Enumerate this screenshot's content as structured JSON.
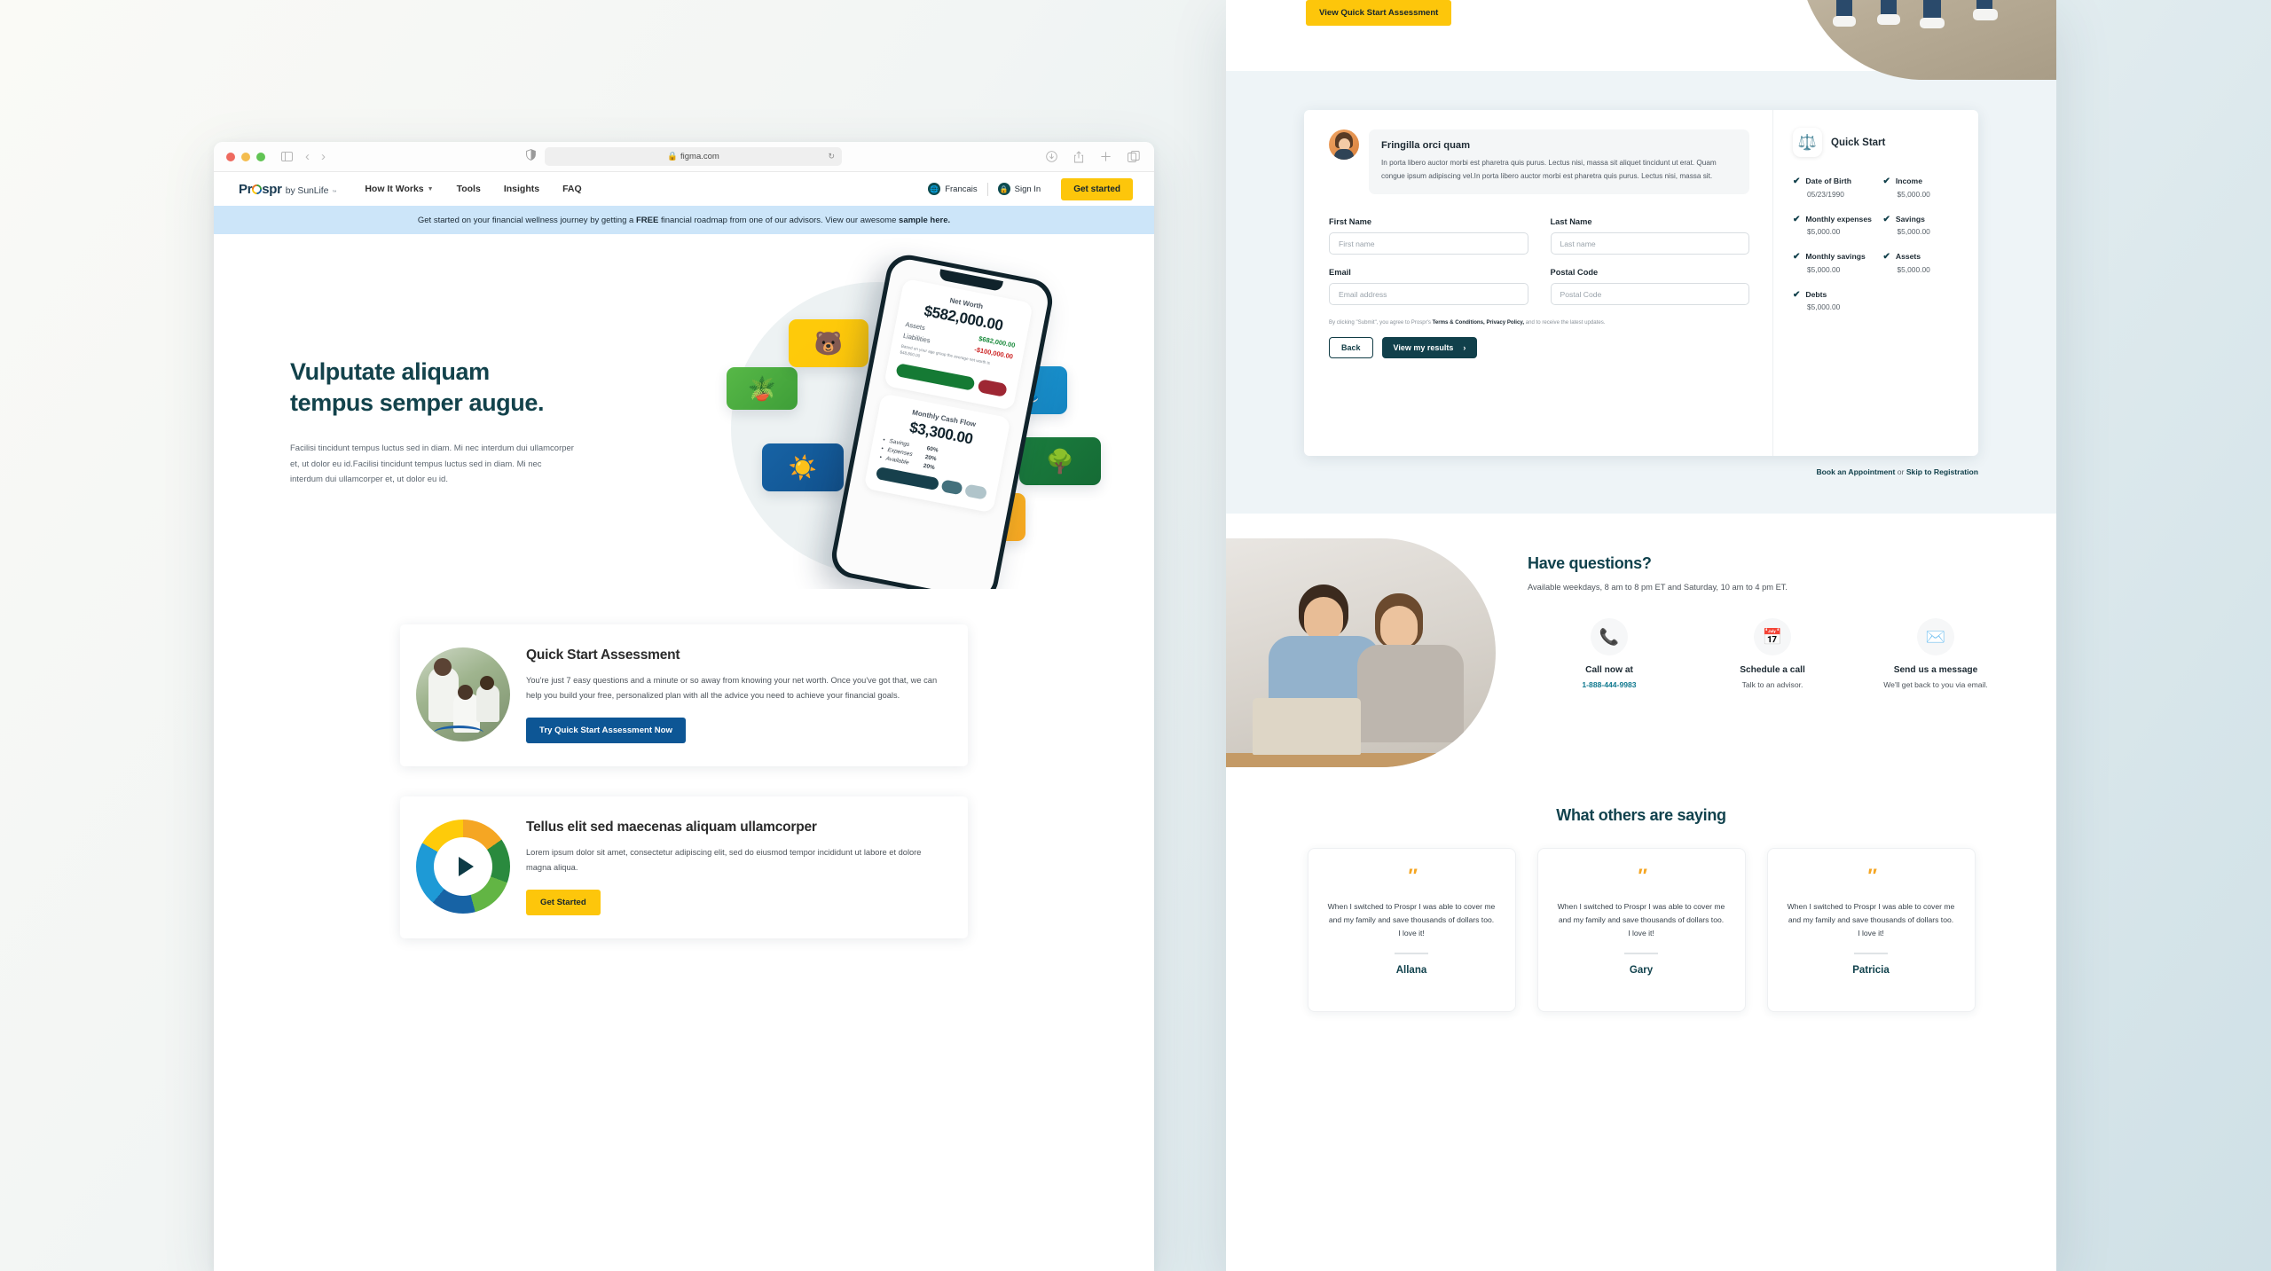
{
  "browser": {
    "url": "figma.com",
    "lock_icon": "lock-icon",
    "reload_icon": "reload-icon",
    "sidebar_icon": "sidebar-toggle-icon",
    "back_icon": "back-arrow-icon",
    "forward_icon": "forward-arrow-icon",
    "shield_icon": "shield-icon",
    "download_icon": "download-icon",
    "share_icon": "share-icon",
    "newtab_icon": "plus-icon",
    "tabs_icon": "tabs-icon"
  },
  "nav": {
    "brand_name": "Prospr",
    "brand_o": "o",
    "brand_suffix": "by SunLife",
    "brand_tm": "™",
    "links": [
      {
        "label": "How It Works",
        "has_caret": true
      },
      {
        "label": "Tools",
        "has_caret": false
      },
      {
        "label": "Insights",
        "has_caret": false
      },
      {
        "label": "FAQ",
        "has_caret": false
      }
    ],
    "language": "Francais",
    "signin": "Sign In",
    "get_started": "Get started"
  },
  "announce": {
    "part1": "Get started on your financial wellness journey by getting a ",
    "free": "FREE",
    "part2": " financial roadmap from one of our advisors. View our awesome ",
    "sample": "sample here."
  },
  "hero": {
    "heading": "Vulputate aliquam tempus semper augue.",
    "paragraph": "Facilisi tincidunt tempus luctus sed in diam. Mi nec interdum dui ullamcorper et, ut dolor eu id.Facilisi tincidunt tempus luctus sed in diam. Mi nec interdum dui ullamcorper et, ut dolor eu id.",
    "tiles": [
      {
        "name": "plant-tile",
        "emoji": "🪴"
      },
      {
        "name": "bear-tile",
        "emoji": "🐻"
      },
      {
        "name": "sun-tile",
        "emoji": "☀️"
      },
      {
        "name": "shoes-tile",
        "emoji": "👟"
      },
      {
        "name": "tree-tile",
        "emoji": "🌳"
      },
      {
        "name": "stroller-tile",
        "emoji": "🛍️"
      }
    ],
    "phone": {
      "net_worth_label": "Net Worth",
      "net_worth_value": "$582,000.00",
      "assets_label": "Assets",
      "assets_value": "$682,000.00",
      "liabilities_label": "Liabilities",
      "liabilities_value": "-$100,000.00",
      "note": "Based on your age group the average net worth is $48,800.00",
      "cashflow_label": "Monthly Cash Flow",
      "cashflow_value": "$3,300.00",
      "breakdown": [
        {
          "name": "Savings",
          "value": "60%"
        },
        {
          "name": "Expenses",
          "value": "20%"
        },
        {
          "name": "Available",
          "value": "20%"
        }
      ]
    }
  },
  "cards": [
    {
      "title": "Quick Start Assessment",
      "body": "You're just 7 easy questions and a minute or so away from knowing your net worth. Once you've got that, we can help you build your free, personalized plan with all the advice you need to achieve your financial goals.",
      "button": "Try Quick Start Assessment Now"
    },
    {
      "title": "Tellus elit sed maecenas aliquam ullamcorper",
      "body": "Lorem ipsum dolor sit amet, consectetur adipiscing elit, sed do eiusmod tempor incididunt ut labore et dolore magna aliqua.",
      "button": "Get Started"
    }
  ],
  "right_panel": {
    "view_qsa_button": "View Quick Start Assessment",
    "advisor": {
      "title": "Fringilla orci quam",
      "body": "In porta libero auctor morbi est pharetra quis purus. Lectus nisi, massa sit aliquet tincidunt ut erat. Quam congue ipsum adipiscing vel.In porta libero auctor morbi est pharetra quis purus. Lectus nisi, massa sit."
    },
    "form": {
      "fields": [
        {
          "label": "First Name",
          "placeholder": "First name",
          "value": ""
        },
        {
          "label": "Last Name",
          "placeholder": "Last name",
          "value": ""
        },
        {
          "label": "Email",
          "placeholder": "Email address",
          "value": ""
        },
        {
          "label": "Postal Code",
          "placeholder": "Postal Code",
          "value": ""
        }
      ],
      "legal_pre": "By clicking \"Submit\", you agree to Prospr's ",
      "legal_terms": "Terms & Conditions,",
      "legal_privacy": "Privacy Policy,",
      "legal_post": " and to receive the latest updates.",
      "back_button": "Back",
      "results_button": "View my results",
      "results_chevron": "›"
    },
    "quick_start": {
      "icon": "balance-scale-icon",
      "title": "Quick Start",
      "items": [
        {
          "name": "Date of Birth",
          "value": "05/23/1990"
        },
        {
          "name": "Income",
          "value": "$5,000.00"
        },
        {
          "name": "Monthly expenses",
          "value": "$5,000.00"
        },
        {
          "name": "Savings",
          "value": "$5,000.00"
        },
        {
          "name": "Monthly savings",
          "value": "$5,000.00"
        },
        {
          "name": "Assets",
          "value": "$5,000.00"
        },
        {
          "name": "Debts",
          "value": "$5,000.00"
        }
      ],
      "check_glyph": "✔"
    },
    "links": {
      "book": "Book an Appointment",
      "or": " or ",
      "skip": "Skip to Registration"
    },
    "questions": {
      "heading": "Have questions?",
      "subheading": "Available weekdays, 8 am to 8 pm ET and Saturday, 10 am to 4 pm ET.",
      "columns": [
        {
          "icon": "phone-icon",
          "glyph": "📞",
          "title": "Call now at",
          "detail": "1-888-444-9983",
          "is_tel": true
        },
        {
          "icon": "calendar-icon",
          "glyph": "📅",
          "title": "Schedule a call",
          "detail": "Talk to an advisor.",
          "is_tel": false
        },
        {
          "icon": "envelope-icon",
          "glyph": "✉️",
          "title": "Send us a message",
          "detail": "We'll get back to you via email.",
          "is_tel": false
        }
      ]
    },
    "testimonials": {
      "heading": "What others are saying",
      "quote_glyph": "″",
      "items": [
        {
          "text": "When I switched to Prospr I was able to cover me and my family and save thousands of dollars too. I love it!",
          "name": "Allana"
        },
        {
          "text": "When I switched to Prospr I was able to cover me and my family and save thousands of dollars too. I love it!",
          "name": "Gary"
        },
        {
          "text": "When I switched to Prospr I was able to cover me and my family and save thousands of dollars too. I love it!",
          "name": "Patricia"
        }
      ]
    }
  },
  "colors": {
    "brand_teal": "#11424d",
    "brand_yellow": "#fdc60b",
    "brand_blue": "#0d5695",
    "announce_bg": "#cce5f9",
    "panel_band": "#eef4f7",
    "positive": "#1a8b3c",
    "negative": "#cc2222"
  }
}
